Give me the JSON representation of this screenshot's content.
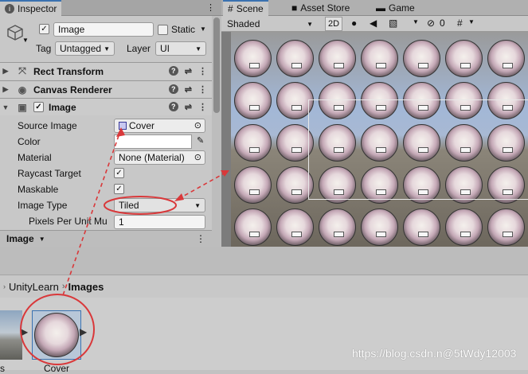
{
  "inspector": {
    "tab_label": "Inspector",
    "object_name": "Image",
    "object_active": true,
    "static_label": "Static",
    "tag_label": "Tag",
    "tag_value": "Untagged",
    "layer_label": "Layer",
    "layer_value": "UI",
    "components": [
      {
        "name": "Rect Transform",
        "expanded": false
      },
      {
        "name": "Canvas Renderer",
        "expanded": false
      },
      {
        "name": "Image",
        "expanded": true,
        "enabled": true
      }
    ],
    "help_glyph": "?",
    "properties": {
      "source_image_label": "Source Image",
      "source_image_value": "Cover",
      "color_label": "Color",
      "material_label": "Material",
      "material_value": "None (Material)",
      "raycast_label": "Raycast Target",
      "raycast_value": true,
      "maskable_label": "Maskable",
      "maskable_value": true,
      "image_type_label": "Image Type",
      "image_type_value": "Tiled",
      "ppu_label": "Pixels Per Unit Mu",
      "ppu_value": "1"
    },
    "bottom_label": "Image"
  },
  "scene": {
    "tabs": [
      {
        "label": "Scene",
        "icon": "hash-icon",
        "active": true
      },
      {
        "label": "Asset Store",
        "icon": "bag-icon",
        "active": false
      },
      {
        "label": "Game",
        "icon": "gamepad-icon",
        "active": false
      }
    ],
    "shading_mode": "Shaded",
    "mode_2d": "2D",
    "hidden_count": "0",
    "rows": 5,
    "cols": 6
  },
  "project": {
    "breadcrumb_parent": "UnityLearn",
    "breadcrumb_current": "Images",
    "assets": [
      {
        "label": "s"
      },
      {
        "label": "Cover"
      }
    ]
  },
  "watermark": "https://blog.csdn.n@5tWdy12003",
  "colors": {
    "annotation": "#d9383a",
    "accent": "#3a72b0"
  }
}
